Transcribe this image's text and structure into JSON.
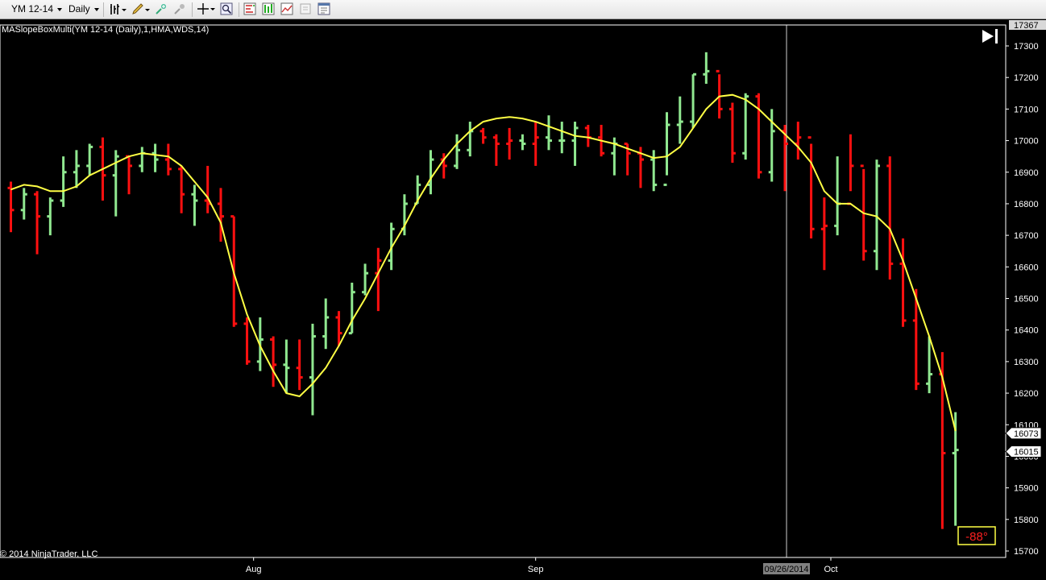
{
  "toolbar": {
    "instrument": "YM 12-14",
    "interval": "Daily",
    "icons": [
      "bar-style-icon",
      "pencil-draw-icon",
      "zoom-in-icon",
      "zoom-out-icon",
      "crosshair-icon",
      "magnify-icon",
      "indicators-icon",
      "strategies-icon",
      "chart-trader-icon",
      "data-box-icon",
      "properties-icon"
    ]
  },
  "chart_data": {
    "type": "ohlc",
    "indicator_label": "MASlopeBoxMulti(YM 12-14 (Daily),1,HMA,WDS,14)",
    "copyright": "© 2014 NinjaTrader, LLC",
    "y_ticks": [
      15700,
      15800,
      15900,
      16000,
      16100,
      16200,
      16300,
      16400,
      16500,
      16600,
      16700,
      16800,
      16900,
      17000,
      17100,
      17200,
      17300
    ],
    "ylim": [
      15700,
      17367
    ],
    "top_label": "17367",
    "x_labels": [
      {
        "label": "Aug",
        "index": 18.5
      },
      {
        "label": "Sep",
        "index": 40
      },
      {
        "label": "Oct",
        "index": 62.5
      }
    ],
    "cursor": {
      "label": "09/26/2014",
      "index": 59
    },
    "price_markers": [
      {
        "value": 16073,
        "label": "16073"
      },
      {
        "value": 16015,
        "label": "16015"
      }
    ],
    "slope_box": {
      "label": "-88°",
      "color": "#ff2020"
    },
    "colors": {
      "up": "#90e890",
      "down": "#ff1010",
      "ma": "#ffff44",
      "axis": "#ffffff",
      "background": "#000000"
    },
    "bars": [
      [
        16850,
        16870,
        16710,
        16780,
        "d"
      ],
      [
        16780,
        16850,
        16750,
        16830,
        "u"
      ],
      [
        16830,
        16840,
        16640,
        16760,
        "d"
      ],
      [
        16760,
        16820,
        16700,
        16810,
        "u"
      ],
      [
        16810,
        16950,
        16790,
        16900,
        "u"
      ],
      [
        16900,
        16970,
        16850,
        16920,
        "u"
      ],
      [
        16920,
        16990,
        16890,
        16980,
        "u"
      ],
      [
        16980,
        17010,
        16810,
        16890,
        "d"
      ],
      [
        16890,
        16970,
        16760,
        16950,
        "u"
      ],
      [
        16950,
        16950,
        16830,
        16920,
        "d"
      ],
      [
        16920,
        16980,
        16900,
        16960,
        "u"
      ],
      [
        16960,
        16990,
        16900,
        16940,
        "u"
      ],
      [
        16940,
        16990,
        16890,
        16910,
        "d"
      ],
      [
        16910,
        16920,
        16770,
        16830,
        "d"
      ],
      [
        16830,
        16860,
        16730,
        16810,
        "u"
      ],
      [
        16810,
        16920,
        16770,
        16800,
        "d"
      ],
      [
        16800,
        16850,
        16680,
        16760,
        "d"
      ],
      [
        16760,
        16760,
        16410,
        16420,
        "d"
      ],
      [
        16420,
        16440,
        16290,
        16300,
        "d"
      ],
      [
        16300,
        16440,
        16270,
        16370,
        "u"
      ],
      [
        16370,
        16380,
        16220,
        16290,
        "d"
      ],
      [
        16290,
        16370,
        16200,
        16280,
        "u"
      ],
      [
        16280,
        16370,
        16210,
        16250,
        "d"
      ],
      [
        16250,
        16420,
        16130,
        16380,
        "u"
      ],
      [
        16380,
        16500,
        16340,
        16440,
        "u"
      ],
      [
        16440,
        16460,
        16350,
        16390,
        "d"
      ],
      [
        16390,
        16550,
        16390,
        16520,
        "u"
      ],
      [
        16520,
        16610,
        16510,
        16580,
        "u"
      ],
      [
        16580,
        16660,
        16460,
        16620,
        "d"
      ],
      [
        16620,
        16740,
        16590,
        16720,
        "u"
      ],
      [
        16720,
        16830,
        16700,
        16800,
        "u"
      ],
      [
        16800,
        16890,
        16800,
        16860,
        "u"
      ],
      [
        16860,
        16970,
        16830,
        16940,
        "u"
      ],
      [
        16940,
        16960,
        16880,
        16920,
        "d"
      ],
      [
        16920,
        17020,
        16910,
        16970,
        "u"
      ],
      [
        16970,
        17060,
        16950,
        17030,
        "u"
      ],
      [
        17030,
        17040,
        16990,
        17010,
        "d"
      ],
      [
        17010,
        17020,
        16920,
        16990,
        "d"
      ],
      [
        16990,
        17040,
        16940,
        17000,
        "d"
      ],
      [
        17000,
        17020,
        16970,
        16990,
        "u"
      ],
      [
        16990,
        17060,
        16920,
        17010,
        "d"
      ],
      [
        17010,
        17080,
        16970,
        17000,
        "u"
      ],
      [
        17000,
        17060,
        16960,
        17000,
        "u"
      ],
      [
        17000,
        17060,
        16920,
        17040,
        "u"
      ],
      [
        17040,
        17050,
        16980,
        17010,
        "d"
      ],
      [
        17010,
        17050,
        16950,
        16960,
        "d"
      ],
      [
        16960,
        17010,
        16890,
        16990,
        "u"
      ],
      [
        16990,
        16990,
        16890,
        16960,
        "d"
      ],
      [
        16960,
        16980,
        16850,
        16940,
        "d"
      ],
      [
        16940,
        16970,
        16840,
        16860,
        "u"
      ],
      [
        16860,
        17090,
        16890,
        17050,
        "u"
      ],
      [
        17050,
        17140,
        16990,
        17060,
        "u"
      ],
      [
        17060,
        17210,
        17040,
        17210,
        "u"
      ],
      [
        17210,
        17280,
        17180,
        17220,
        "u"
      ],
      [
        17220,
        17210,
        17070,
        17100,
        "d"
      ],
      [
        17100,
        17120,
        16930,
        16960,
        "d"
      ],
      [
        16960,
        17150,
        16940,
        17140,
        "u"
      ],
      [
        17140,
        17150,
        16880,
        16900,
        "d"
      ],
      [
        16900,
        17100,
        16870,
        17030,
        "u"
      ],
      [
        17030,
        17050,
        16840,
        16990,
        "d"
      ],
      [
        16990,
        17060,
        16940,
        17010,
        "d"
      ],
      [
        17010,
        16990,
        16690,
        16720,
        "d"
      ],
      [
        16720,
        16820,
        16590,
        16730,
        "d"
      ],
      [
        16730,
        16950,
        16700,
        16800,
        "u"
      ],
      [
        16800,
        17020,
        16840,
        16920,
        "d"
      ],
      [
        16920,
        16910,
        16620,
        16650,
        "d"
      ],
      [
        16650,
        16940,
        16590,
        16920,
        "u"
      ],
      [
        16920,
        16950,
        16560,
        16610,
        "d"
      ],
      [
        16610,
        16690,
        16410,
        16430,
        "d"
      ],
      [
        16430,
        16530,
        16210,
        16230,
        "d"
      ],
      [
        16230,
        16380,
        16200,
        16260,
        "u"
      ],
      [
        16260,
        16330,
        15770,
        16010,
        "d"
      ],
      [
        16010,
        16140,
        15780,
        16020,
        "u"
      ]
    ],
    "ma": [
      16845,
      16860,
      16855,
      16840,
      16840,
      16855,
      16890,
      16910,
      16930,
      16950,
      16960,
      16955,
      16950,
      16920,
      16870,
      16820,
      16740,
      16580,
      16450,
      16350,
      16270,
      16200,
      16190,
      16230,
      16280,
      16350,
      16430,
      16500,
      16580,
      16660,
      16730,
      16810,
      16880,
      16940,
      16990,
      17030,
      17060,
      17070,
      17075,
      17070,
      17060,
      17045,
      17030,
      17015,
      17010,
      17000,
      16990,
      16975,
      16960,
      16945,
      16950,
      16980,
      17040,
      17100,
      17140,
      17145,
      17130,
      17100,
      17060,
      17020,
      16980,
      16930,
      16840,
      16800,
      16800,
      16770,
      16760,
      16720,
      16620,
      16500,
      16380,
      16250,
      16080
    ],
    "x_axis_pad_bars": 0
  }
}
